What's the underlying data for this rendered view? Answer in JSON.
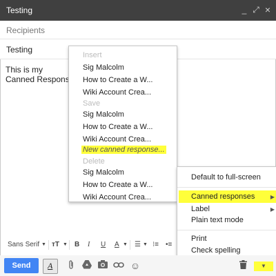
{
  "window": {
    "title": "Testing",
    "controls": [
      "_",
      "⤢",
      "×"
    ]
  },
  "compose": {
    "recipients_placeholder": "Recipients",
    "subject": "Testing",
    "body_line1": "This is my",
    "body_line2": "Canned Response"
  },
  "canned_menu": {
    "insert_header": "Insert",
    "insert_items": [
      "Sig Malcolm",
      "How to Create a W...",
      "Wiki Account Crea..."
    ],
    "save_header": "Save",
    "save_items": [
      "Sig Malcolm",
      "How to Create a W...",
      "Wiki Account Crea..."
    ],
    "new_item": "New canned response...",
    "delete_header": "Delete",
    "delete_items": [
      "Sig Malcolm",
      "How to Create a W...",
      "Wiki Account Crea..."
    ]
  },
  "more_menu": {
    "default_full_screen": "Default to full-screen",
    "canned_responses": "Canned responses",
    "label": "Label",
    "plain_text": "Plain text mode",
    "print": "Print",
    "check_spelling": "Check spelling"
  },
  "format_bar": {
    "font": "Sans Serif",
    "size_icon": "тT",
    "bold": "B",
    "italic": "I",
    "underline": "U",
    "text_color": "A"
  },
  "bottom_bar": {
    "send": "Send",
    "format_toggle": "A"
  },
  "colors": {
    "title_bar": "#404040",
    "send_button": "#4285f4",
    "highlight": "#ffff3a"
  }
}
